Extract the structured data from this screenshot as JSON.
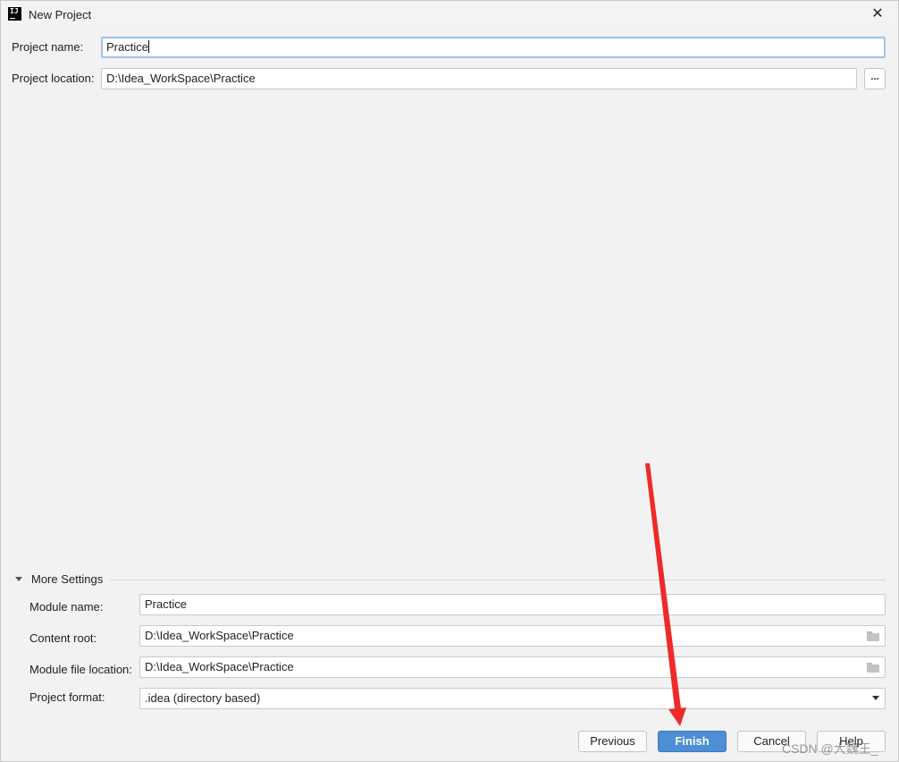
{
  "window": {
    "title": "New Project",
    "close_glyph": "✕",
    "app_icon_text": "IJ"
  },
  "project": {
    "name_label": "Project name:",
    "name_value": "Practice",
    "location_label": "Project location:",
    "location_value": "D:\\Idea_WorkSpace\\Practice",
    "browse_label": "..."
  },
  "more_settings": {
    "title": "More Settings",
    "module_name_label": "Module name:",
    "module_name_value": "Practice",
    "content_root_label": "Content root:",
    "content_root_value": "D:\\Idea_WorkSpace\\Practice",
    "module_file_label": "Module file location:",
    "module_file_value": "D:\\Idea_WorkSpace\\Practice",
    "format_label": "Project format:",
    "format_value": ".idea (directory based)"
  },
  "buttons": {
    "previous": "Previous",
    "finish": "Finish",
    "cancel": "Cancel",
    "help": "Help"
  },
  "watermark": "CSDN @大魏王_",
  "icons": [
    "app-icon",
    "close-icon",
    "triangle-down-icon",
    "folder-icon",
    "combo-arrow-icon",
    "red-arrow-annotation"
  ],
  "colors": {
    "primary_button": "#4d8ed4",
    "focus_border": "#9ec2ef",
    "annotation": "#ee2a2a"
  }
}
